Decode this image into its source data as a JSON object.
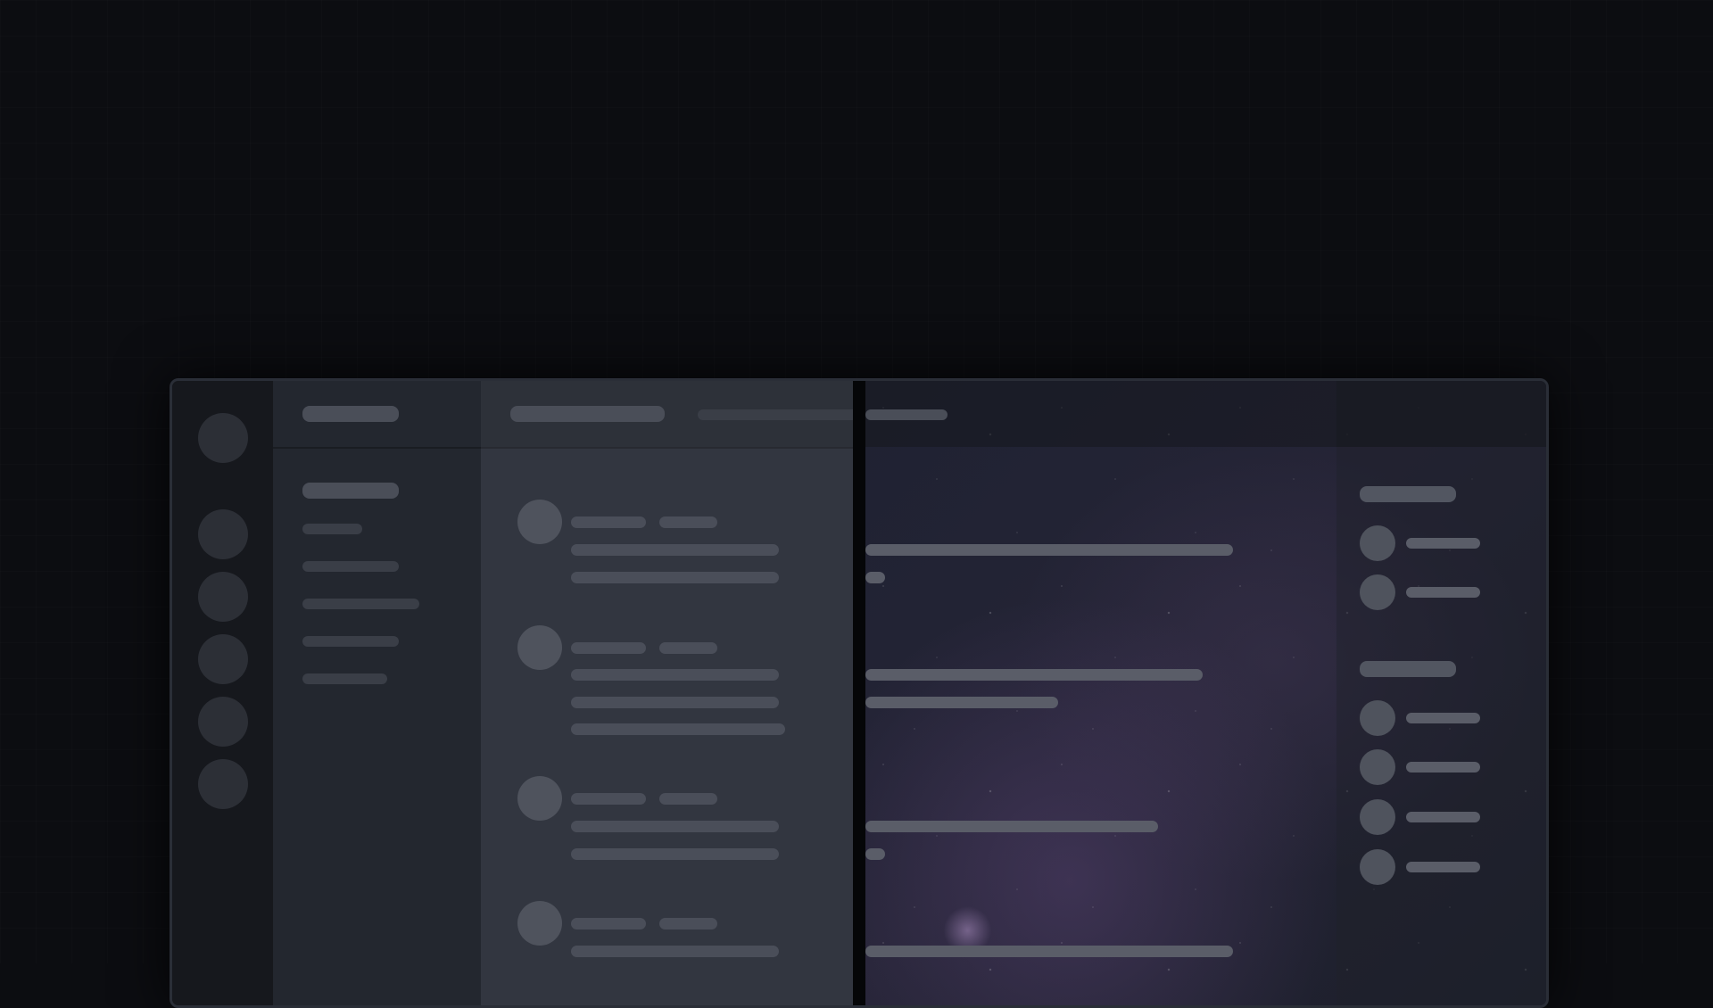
{
  "window": {
    "server_count": 6,
    "channel_items": 6,
    "message_groups": 4,
    "member_groups": [
      {
        "header": true,
        "members": 2
      },
      {
        "header": true,
        "members": 4
      }
    ]
  },
  "icons": {
    "server": "server-avatar-icon",
    "user": "user-avatar-icon"
  },
  "colors": {
    "page_background": "#0c0d11",
    "rail": "#16181d",
    "sidebar": "#23272f",
    "chat_left": "#323640",
    "handle": "#050608"
  }
}
